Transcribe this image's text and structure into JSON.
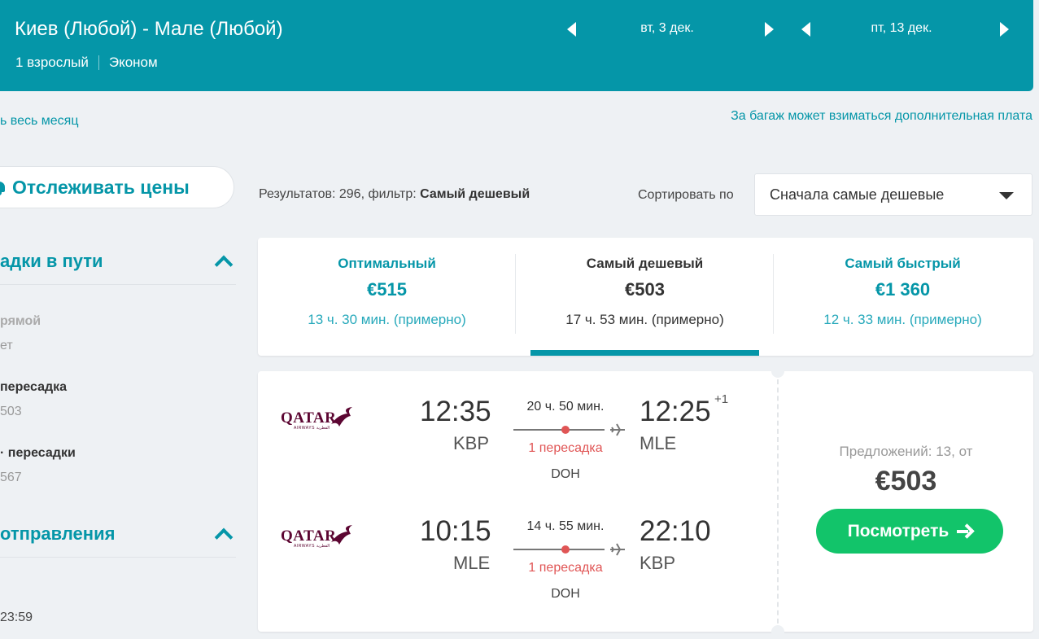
{
  "header": {
    "route": "Киев (Любой) - Мале (Любой)",
    "passengers": "1 взрослый",
    "cabin": "Эконом",
    "depart_date": "вт, 3 дек.",
    "return_date": "пт, 13 дек."
  },
  "links": {
    "month": "ь весь месяц",
    "baggage": "За багаж может взиматься дополнительная плата"
  },
  "sidebar": {
    "track_label": "Отслеживать цены",
    "stops_title": "адки в пути",
    "stop_options": [
      {
        "label": "рямой",
        "value": "ет"
      },
      {
        "label": "пересадка",
        "value": "503"
      },
      {
        "label": "· пересадки",
        "value": "567"
      }
    ],
    "departure_title": "отправления",
    "departure_time": "23:59"
  },
  "results": {
    "count_text": "Результатов: 296, фильтр: ",
    "filter": "Самый дешевый",
    "sort_label": "Сортировать по",
    "sort_value": "Сначала самые дешевые"
  },
  "tabs": [
    {
      "label": "Оптимальный",
      "price": "€515",
      "duration": "13 ч. 30 мин. (примерно)"
    },
    {
      "label": "Самый дешевый",
      "price": "€503",
      "duration": "17 ч. 53 мин. (примерно)"
    },
    {
      "label": "Самый быстрый",
      "price": "€1 360",
      "duration": "12 ч. 33 мин. (примерно)"
    }
  ],
  "result": {
    "airline": "QATAR",
    "airline_sub": "AIRWAYS القطرية",
    "legs": [
      {
        "dep_time": "12:35",
        "dep_code": "KBP",
        "duration": "20 ч. 50 мин.",
        "stops": "1 пересадка",
        "via": "DOH",
        "arr_time": "12:25",
        "arr_code": "MLE",
        "day_offset": "+1"
      },
      {
        "dep_time": "10:15",
        "dep_code": "MLE",
        "duration": "14 ч. 55 мин.",
        "stops": "1 пересадка",
        "via": "DOH",
        "arr_time": "22:10",
        "arr_code": "KBP",
        "day_offset": ""
      }
    ],
    "offers": "Предложений: 13, от",
    "price": "€503",
    "view_label": "Посмотреть"
  },
  "colors": {
    "accent": "#0596a8",
    "cta": "#12c46a",
    "stop_red": "#e05555",
    "airline": "#5c0632"
  }
}
